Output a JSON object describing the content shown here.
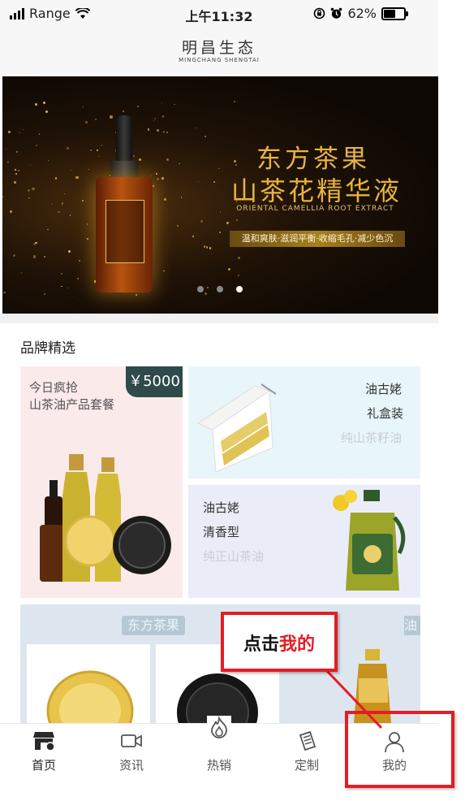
{
  "status_bar": {
    "carrier": "Range",
    "time": "上午11:32",
    "battery_percent": "62%",
    "battery_level": 0.62
  },
  "header": {
    "logo_cn": "明昌生态",
    "logo_en": "MINGCHANG SHENGTAI"
  },
  "banner": {
    "title_line1": "东方茶果",
    "title_line2": "山茶花精华液",
    "subtitle_en": "ORIENTAL CAMELLIA ROOT EXTRACT",
    "tagline": "温和爽肤·滋润平衡·收缩毛孔·减少色沉",
    "carousel_total": 3,
    "carousel_active": 3
  },
  "section": {
    "title": "品牌精选"
  },
  "cards": {
    "promo": {
      "line1": "今日疯抢",
      "line2": "山茶油产品套餐",
      "price": "￥5000"
    },
    "gift": {
      "brand": "油古姥",
      "type": "礼盒装",
      "desc": "纯山茶籽油"
    },
    "qingxiang": {
      "brand": "油古姥",
      "type": "清香型",
      "desc": "纯正山茶油"
    }
  },
  "bottom_row": {
    "pill1": "东方茶果",
    "pill2": "油"
  },
  "tabs": [
    {
      "label": "首页",
      "icon": "store-icon"
    },
    {
      "label": "资讯",
      "icon": "video-icon"
    },
    {
      "label": "热销",
      "icon": "flame-icon"
    },
    {
      "label": "定制",
      "icon": "document-icon"
    },
    {
      "label": "我的",
      "icon": "user-icon"
    }
  ],
  "annotation": {
    "text_prefix": "点击",
    "text_highlight": "我的"
  },
  "colors": {
    "accent_red": "#e51c23",
    "gold": "#e8b441",
    "price_tag": "#2f4a4b"
  }
}
